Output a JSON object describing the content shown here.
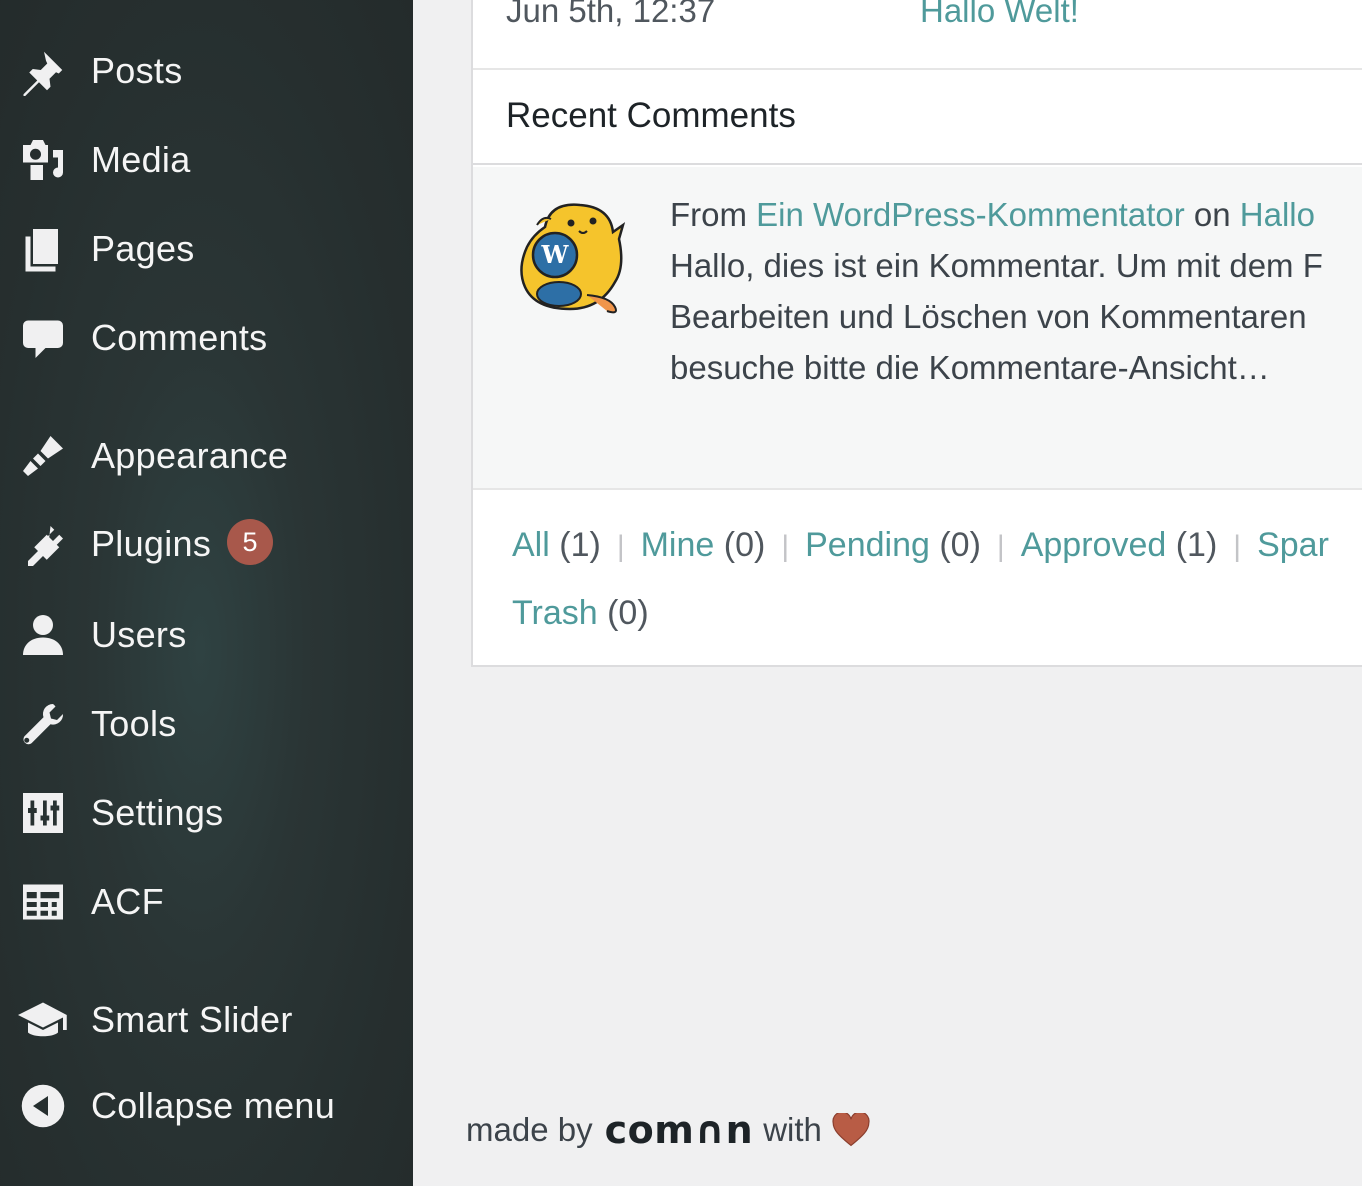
{
  "sidebar": {
    "items": [
      {
        "label": "Posts",
        "icon": "pin-icon"
      },
      {
        "label": "Media",
        "icon": "media-icon"
      },
      {
        "label": "Pages",
        "icon": "pages-icon"
      },
      {
        "label": "Comments",
        "icon": "comment-bubble-icon"
      },
      {
        "label": "Appearance",
        "icon": "paintbrush-icon"
      },
      {
        "label": "Plugins",
        "icon": "plug-icon",
        "badge": "5"
      },
      {
        "label": "Users",
        "icon": "user-icon"
      },
      {
        "label": "Tools",
        "icon": "wrench-icon"
      },
      {
        "label": "Settings",
        "icon": "sliders-icon"
      },
      {
        "label": "ACF",
        "icon": "table-grid-icon"
      },
      {
        "label": "Smart Slider",
        "icon": "graduation-cap-icon"
      },
      {
        "label": "Collapse menu",
        "icon": "collapse-arrow-icon"
      }
    ]
  },
  "activity": {
    "date": "Jun 5th, 12:37",
    "post_link": "Hallo Welt!"
  },
  "recent_comments": {
    "title": "Recent Comments",
    "comment": {
      "from_prefix": "From",
      "author": "Ein WordPress-Kommentator",
      "on_word": "on",
      "post": "Hallo",
      "line1": "Hallo, dies ist ein Kommentar. Um mit dem F",
      "line2": "Bearbeiten und Löschen von Kommentaren",
      "line3": "besuche bitte die Kommentare-Ansicht…"
    },
    "filters": [
      {
        "label": "All",
        "count": "(1)"
      },
      {
        "label": "Mine",
        "count": "(0)"
      },
      {
        "label": "Pending",
        "count": "(0)"
      },
      {
        "label": "Approved",
        "count": "(1)"
      },
      {
        "label": "Spar",
        "count": ""
      },
      {
        "label": "Trash",
        "count": "(0)"
      }
    ]
  },
  "footer": {
    "made_by": "made by",
    "brand": "com∩n",
    "with": "with"
  },
  "colors": {
    "sidebar_bg": "#262f2f",
    "link": "#4f9a9b",
    "badge": "#a8584b",
    "heart": "#b85c45"
  }
}
